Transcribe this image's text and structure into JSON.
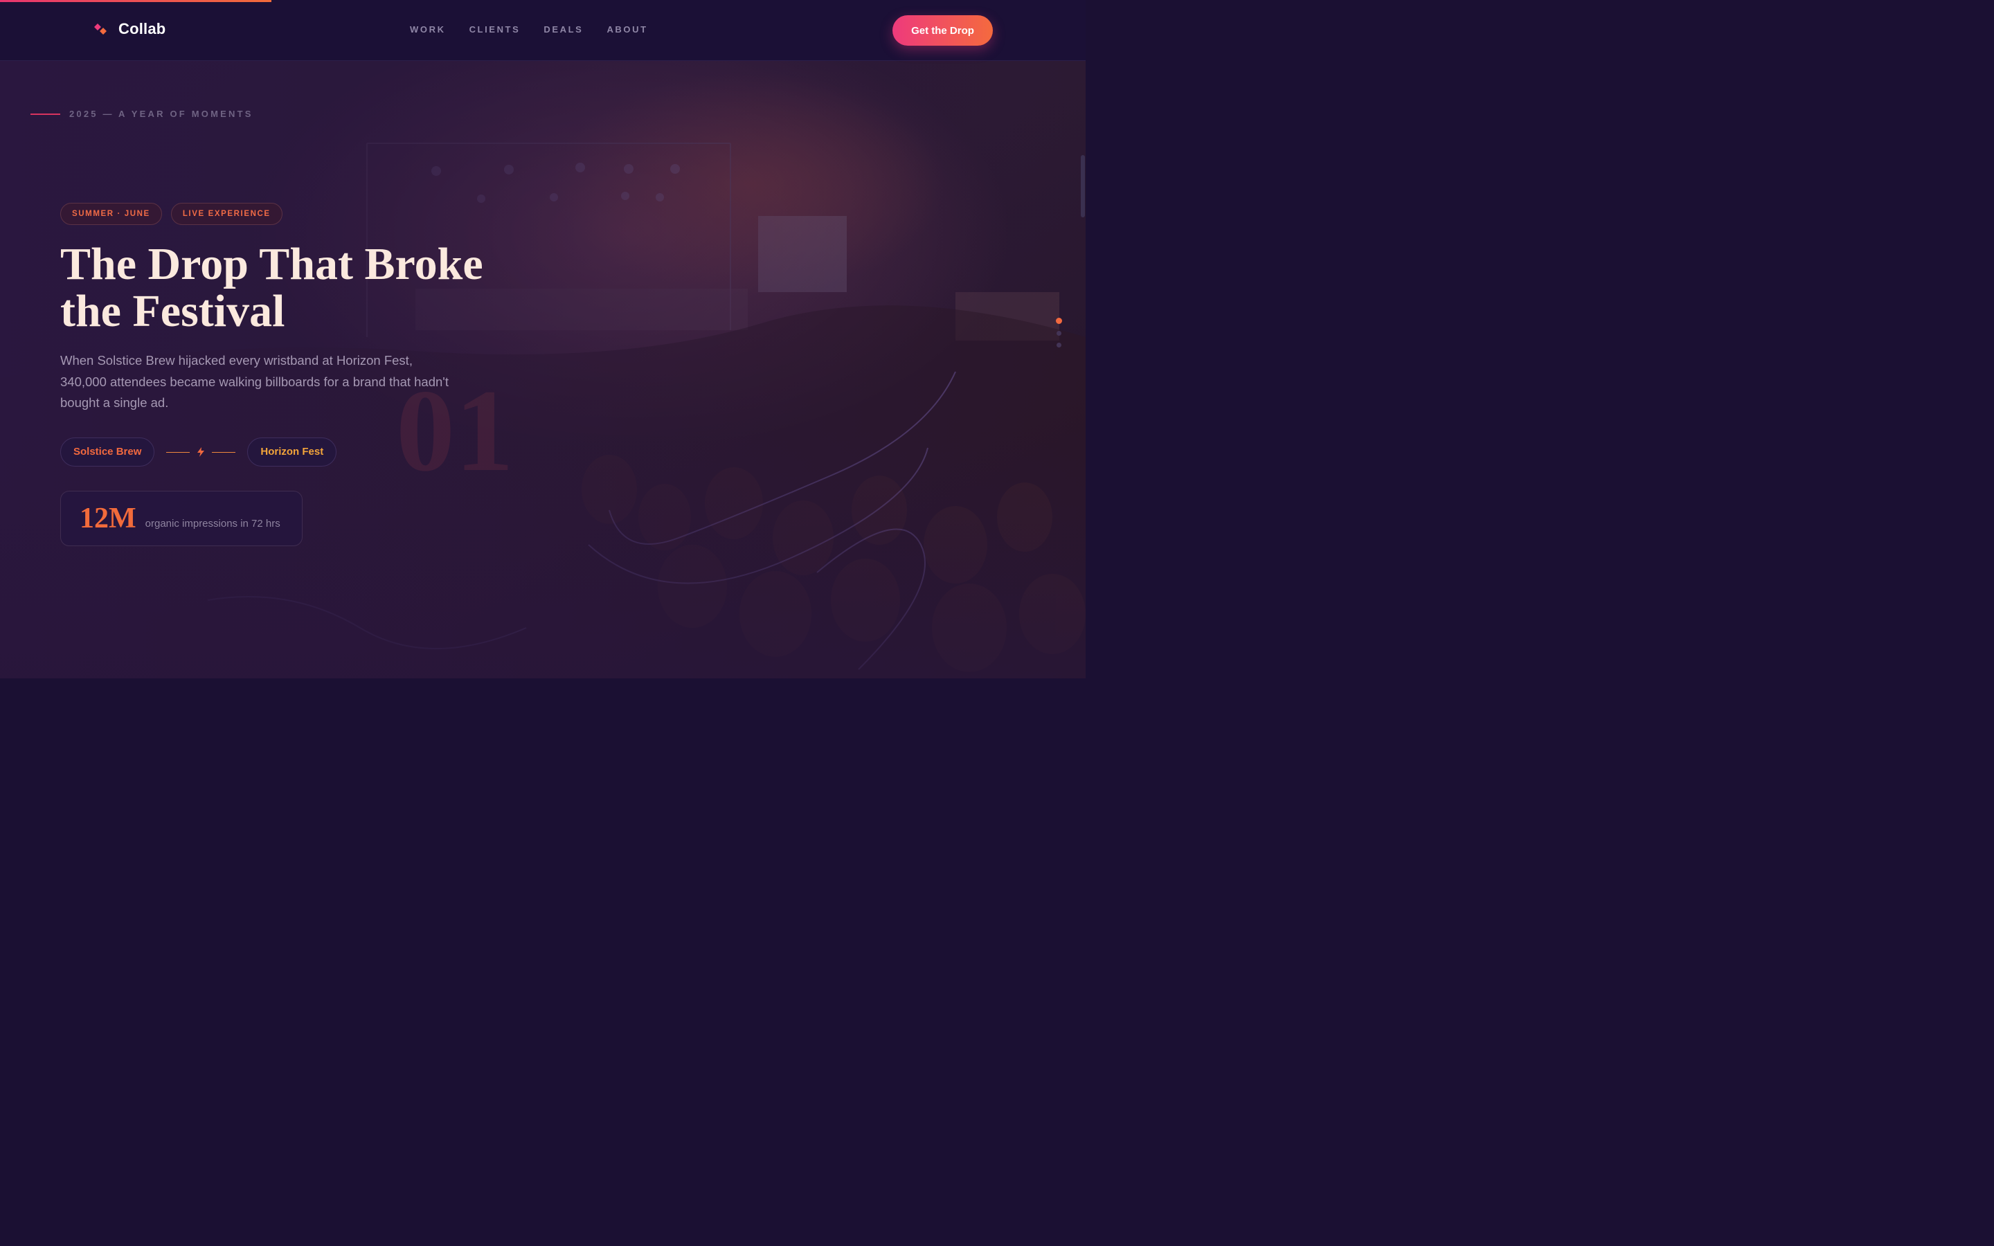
{
  "progress": {
    "fraction": 0.25
  },
  "brand": {
    "name": "Collab",
    "icon": "split-diamond-logo-icon"
  },
  "nav": {
    "links": [
      "WORK",
      "CLIENTS",
      "DEALS",
      "ABOUT"
    ],
    "cta_label": "Get the Drop"
  },
  "hero": {
    "eyebrow": "2025 — A YEAR OF MOMENTS",
    "tags": [
      "SUMMER · JUNE",
      "LIVE EXPERIENCE"
    ],
    "headline_line1": "The Drop That Broke",
    "headline_line2": "the Festival",
    "index_number": "01",
    "description": "When Solstice Brew hijacked every wristband at Horizon Fest, 340,000 attendees became walking billboards for a brand that hadn't bought a single ad.",
    "brand_partner": "Solstice Brew",
    "event_partner": "Horizon Fest",
    "connector_icon": "lightning-bolt-icon",
    "stat_value": "12M",
    "stat_label": "organic impressions in 72 hrs",
    "background": "concert-crowd-photo"
  },
  "slider": {
    "count": 3,
    "active": 1
  },
  "colors": {
    "accent_pink": "#ee3a7c",
    "accent_orange": "#f46a3e",
    "amber": "#f2a43a",
    "background": "#1b1036",
    "headline": "#fbe9de"
  }
}
